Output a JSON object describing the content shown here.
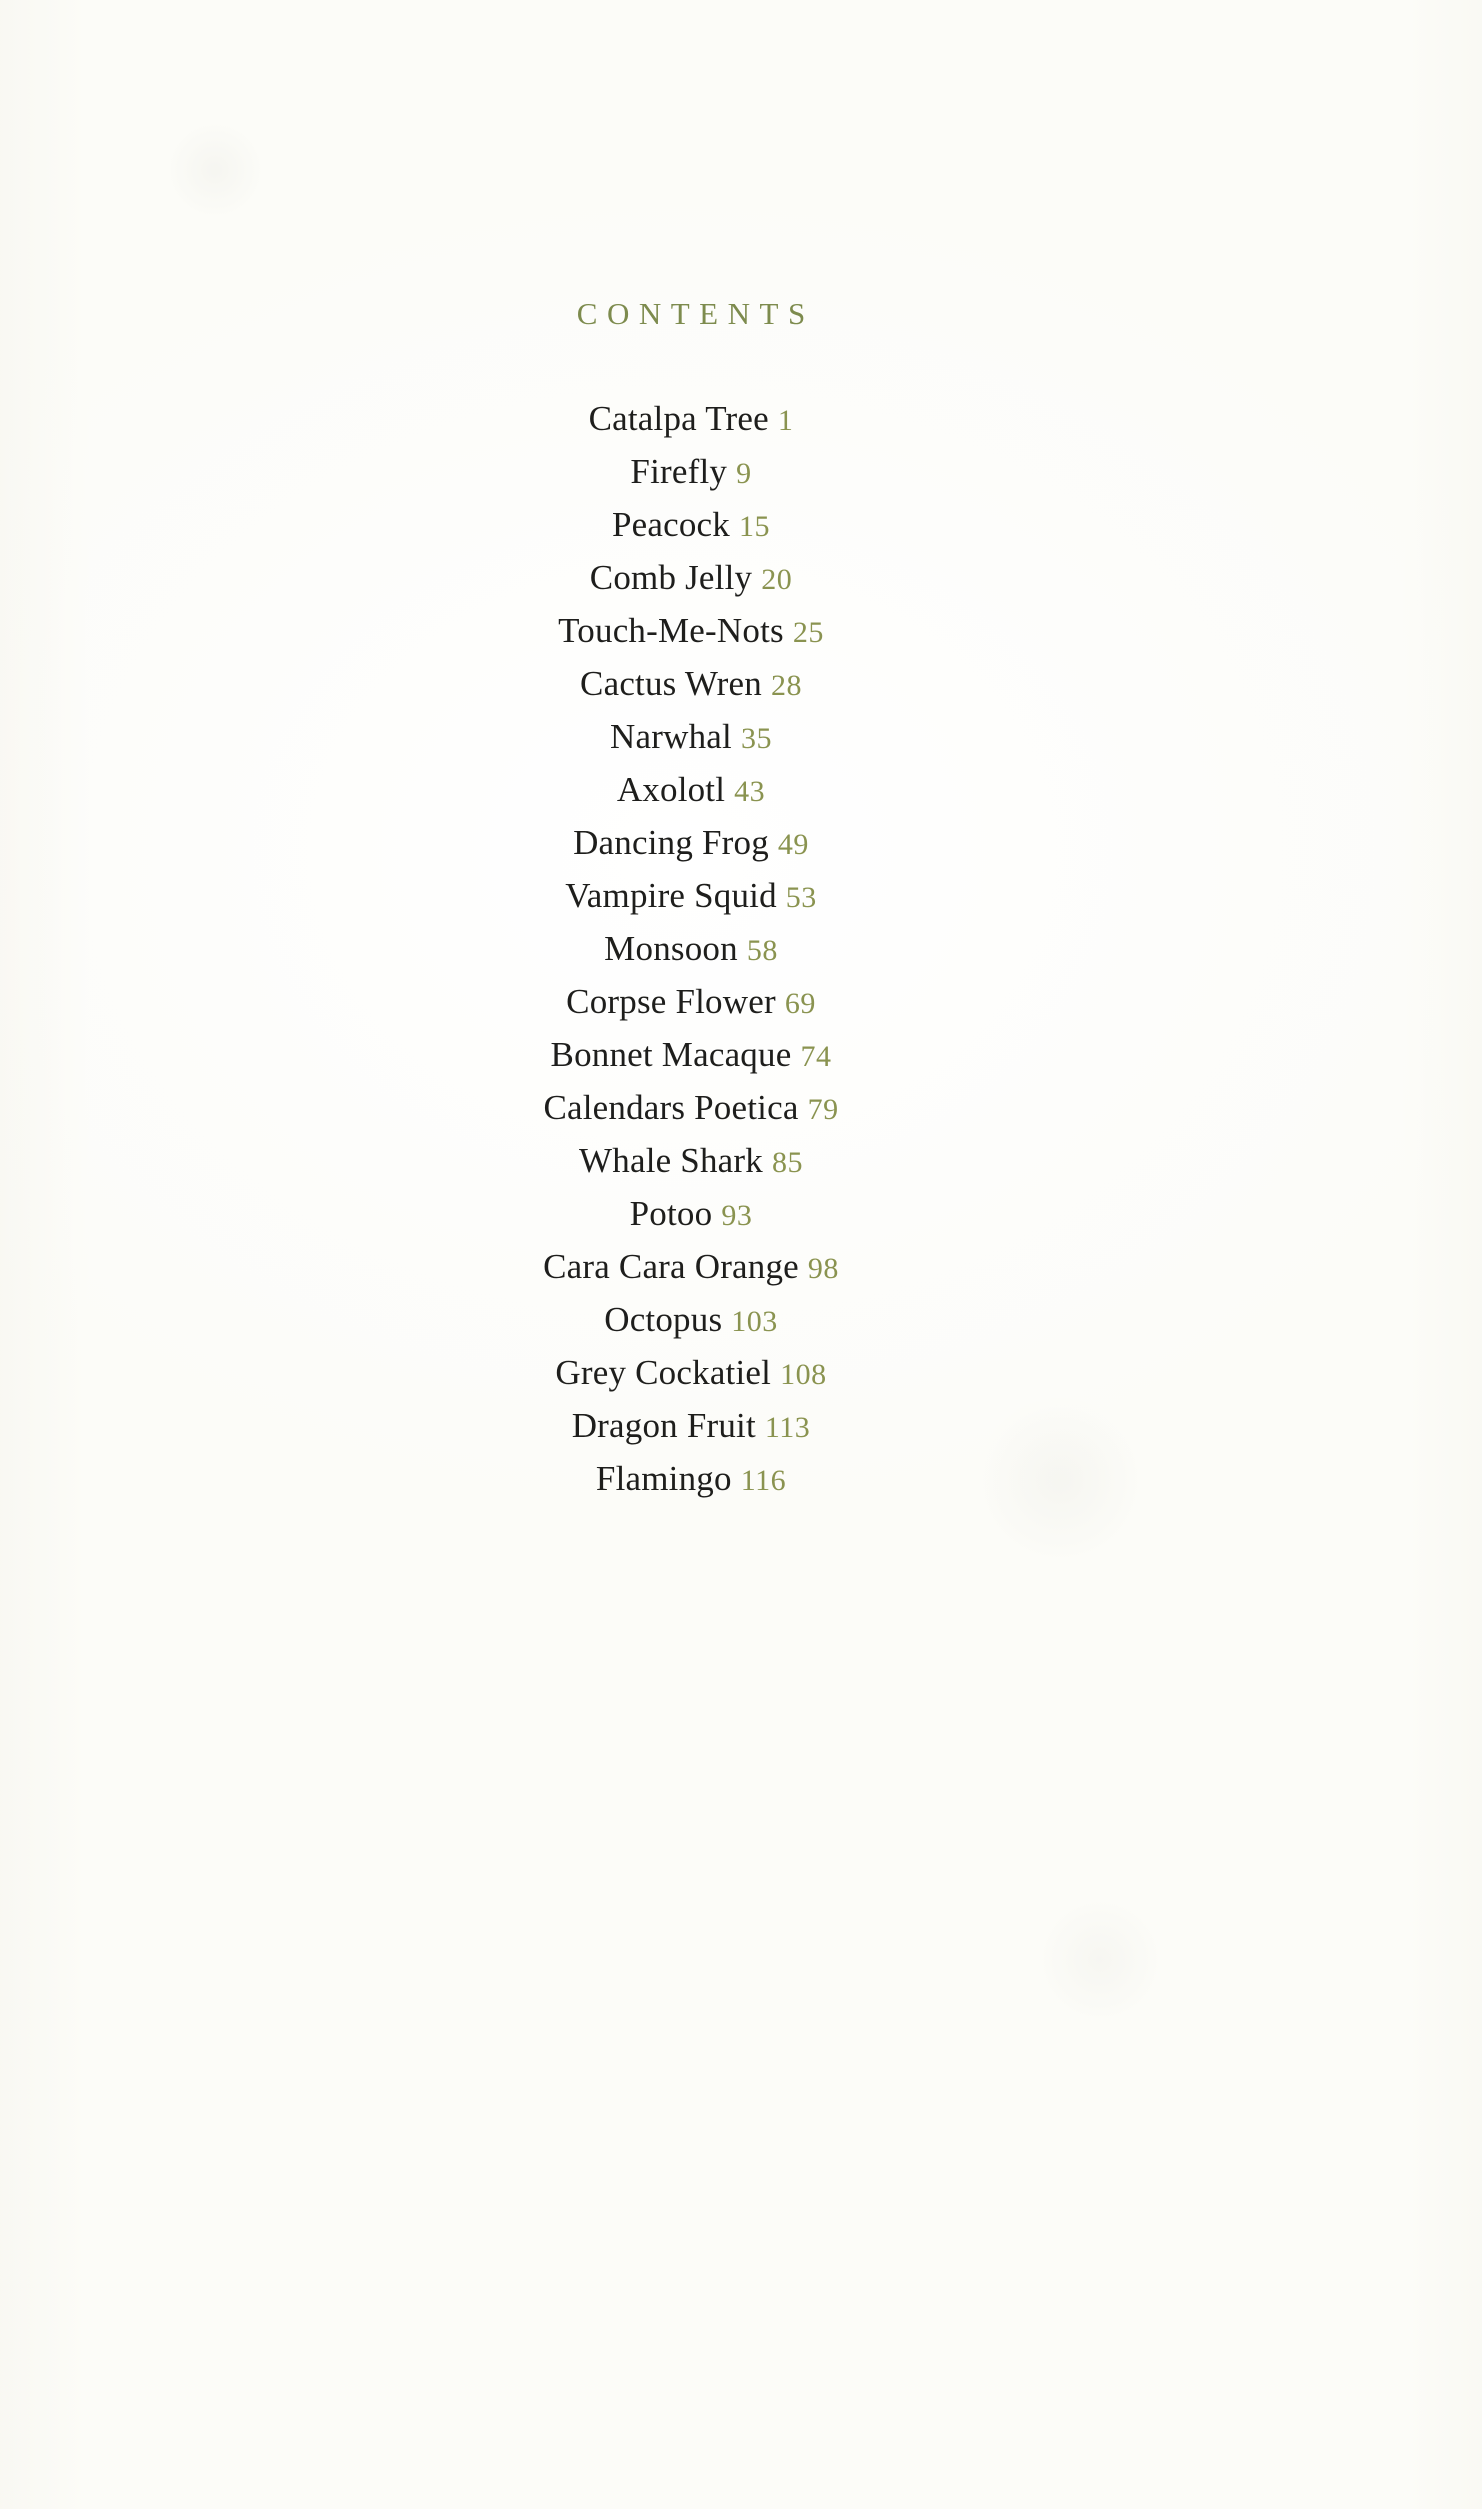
{
  "page": {
    "heading": "CONTENTS",
    "background_color": "#fdfdfb",
    "title_color": "#1e1e1c",
    "page_number_color": "#8a9350",
    "heading_color": "#7d8b4e"
  },
  "contents": {
    "entries": [
      {
        "title": "Catalpa Tree",
        "page": "1"
      },
      {
        "title": "Firefly",
        "page": "9"
      },
      {
        "title": "Peacock",
        "page": "15"
      },
      {
        "title": "Comb Jelly",
        "page": "20"
      },
      {
        "title": "Touch-Me-Nots",
        "page": "25"
      },
      {
        "title": "Cactus Wren",
        "page": "28"
      },
      {
        "title": "Narwhal",
        "page": "35"
      },
      {
        "title": "Axolotl",
        "page": "43"
      },
      {
        "title": "Dancing Frog",
        "page": "49"
      },
      {
        "title": "Vampire Squid",
        "page": "53"
      },
      {
        "title": "Monsoon",
        "page": "58"
      },
      {
        "title": "Corpse Flower",
        "page": "69"
      },
      {
        "title": "Bonnet Macaque",
        "page": "74"
      },
      {
        "title": "Calendars Poetica",
        "page": "79"
      },
      {
        "title": "Whale Shark",
        "page": "85"
      },
      {
        "title": "Potoo",
        "page": "93"
      },
      {
        "title": "Cara Cara Orange",
        "page": "98"
      },
      {
        "title": "Octopus",
        "page": "103"
      },
      {
        "title": "Grey Cockatiel",
        "page": "108"
      },
      {
        "title": "Dragon Fruit",
        "page": "113"
      },
      {
        "title": "Flamingo",
        "page": "116"
      }
    ]
  }
}
